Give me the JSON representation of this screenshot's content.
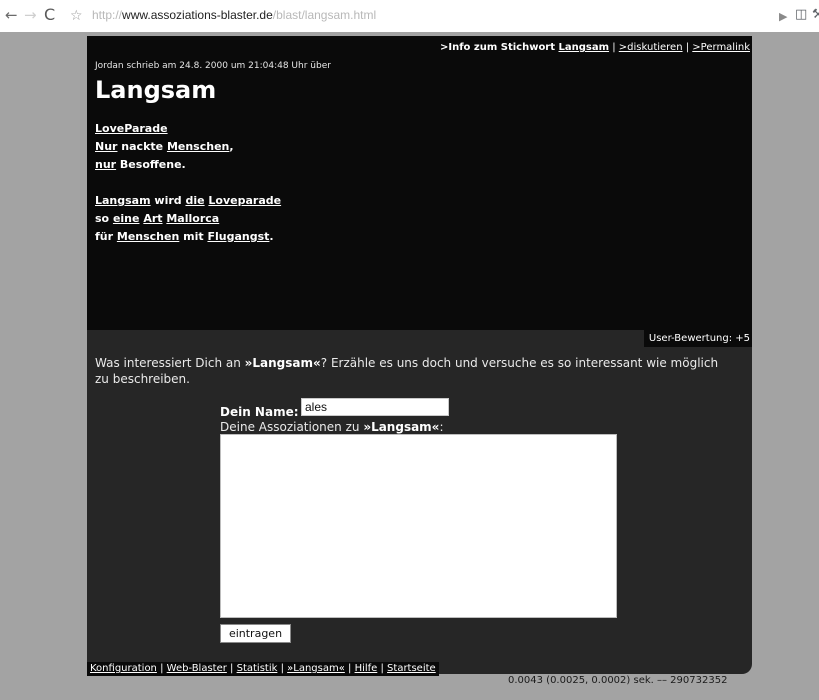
{
  "browser": {
    "url_prefix": "http://",
    "url_host": "www.assoziations-blaster.de",
    "url_path": "/blast/langsam.html"
  },
  "topnav": {
    "info_prefix": ">Info zum Stichwort ",
    "info_link": "Langsam",
    "sep1": " | ",
    "discuss": ">diskutieren",
    "sep2": " | ",
    "permalink": ">Permalink"
  },
  "entry": {
    "meta": "Jordan schrieb am 24.8. 2000 um 21:04:48 Uhr über",
    "title": "Langsam",
    "line1_link1": "LoveParade",
    "line2_link1": "Nur",
    "line2_text1": " nackte ",
    "line2_link2": "Menschen",
    "line2_text2": ",",
    "line3_link1": "nur",
    "line3_text1": " Besoffene.",
    "line4_link1": "Langsam",
    "line4_text1": " wird ",
    "line4_link2": "die",
    "line4_text2": " ",
    "line4_link3": "Loveparade",
    "line5_text1": "so ",
    "line5_link1": "eine",
    "line5_text2": " ",
    "line5_link2": "Art",
    "line5_text3": " ",
    "line5_link3": "Mallorca",
    "line6_text1": "für ",
    "line6_link1": "Menschen",
    "line6_text2": " mit ",
    "line6_link2": "Flugangst",
    "line6_text3": "."
  },
  "rating": "User-Bewertung: +5",
  "form": {
    "prompt_before": "Was interessiert Dich an ",
    "prompt_word": "»Langsam«",
    "prompt_after": "? Erzähle es uns doch und versuche es so interessant wie möglich zu beschreiben.",
    "name_label": "Dein Name:",
    "name_value": "ales",
    "assoc_before": "Deine Assoziationen zu ",
    "assoc_word": "»Langsam«",
    "assoc_after": ":",
    "textarea_value": "",
    "submit_label": "eintragen"
  },
  "footer": {
    "links": [
      "Konfiguration",
      "Web-Blaster",
      "Statistik",
      "»Langsam«",
      "Hilfe",
      "Startseite"
    ],
    "separator": " | ",
    "timing": "0.0043 (0.0025, 0.0002) sek. –– 290732352"
  }
}
